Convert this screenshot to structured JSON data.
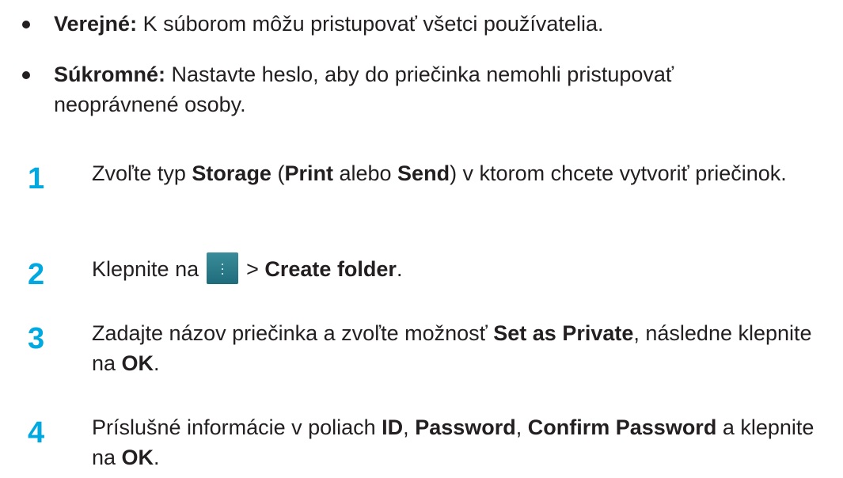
{
  "bullets": [
    {
      "term": "Verejné:",
      "text": " K súborom môžu pristupovať všetci používatelia."
    },
    {
      "term": "Súkromné:",
      "text": " Nastavte heslo, aby do priečinka nemohli pristupovať neoprávnené osoby."
    }
  ],
  "steps": [
    {
      "number": "1",
      "parts": [
        "Zvoľte typ ",
        "Storage",
        " (",
        "Print",
        " alebo ",
        "Send",
        ") v ktorom chcete vytvoriť priečinok."
      ]
    },
    {
      "number": "2",
      "parts": [
        "Klepnite na",
        "menu-icon",
        "> ",
        "Create folder",
        "."
      ]
    },
    {
      "number": "3",
      "parts": [
        "Zadajte názov priečinka a zvoľte možnosť ",
        "Set as Private",
        ", následne klepnite na ",
        "OK",
        "."
      ]
    },
    {
      "number": "4",
      "parts": [
        "Príslušné informácie v poliach ",
        "ID",
        ", ",
        "Password",
        ", ",
        "Confirm Password",
        " a klepnite na ",
        "OK",
        "."
      ]
    }
  ]
}
